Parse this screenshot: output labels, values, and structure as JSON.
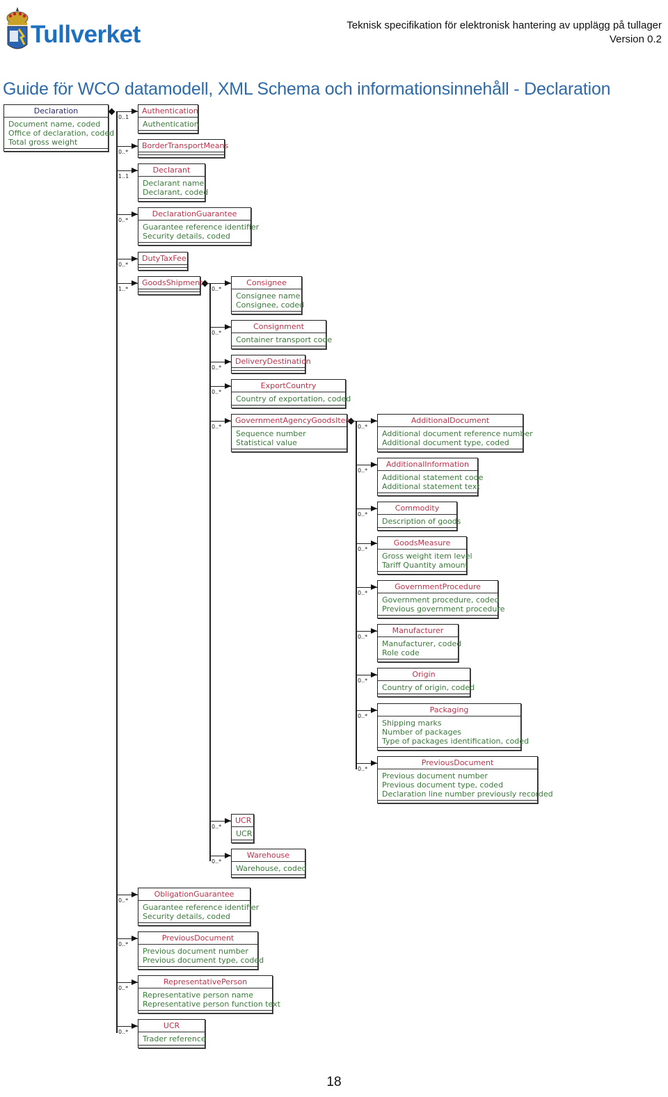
{
  "header": {
    "logo_text": "Tullverket",
    "doc_title": "Teknisk specifikation för elektronisk hantering av upplägg på tullager",
    "version": "Version 0.2"
  },
  "page_title": "Guide för WCO datamodell, XML Schema och informationsinnehåll - Declaration",
  "page_number": "18",
  "diagram": {
    "root": {
      "name": "Declaration",
      "attributes": [
        "Document name, coded",
        "Office of declaration, coded",
        "Total gross weight"
      ]
    },
    "level1": [
      {
        "name": "Authentication",
        "multiplicity": "0..1",
        "attributes": [
          "Authentication"
        ]
      },
      {
        "name": "BorderTransportMeans",
        "multiplicity": "0..*",
        "attributes": []
      },
      {
        "name": "Declarant",
        "multiplicity": "1..1",
        "attributes": [
          "Declarant name",
          "Declarant, coded"
        ]
      },
      {
        "name": "DeclarationGuarantee",
        "multiplicity": "0..*",
        "attributes": [
          "Guarantee reference identifier",
          "Security details, coded"
        ]
      },
      {
        "name": "DutyTaxFee",
        "multiplicity": "0..*",
        "attributes": []
      },
      {
        "name": "GoodsShipment",
        "multiplicity": "1..*",
        "attributes": []
      },
      {
        "name": "ObligationGuarantee",
        "multiplicity": "0..*",
        "attributes": [
          "Guarantee reference identifier",
          "Security details, coded"
        ]
      },
      {
        "name": "PreviousDocument",
        "multiplicity": "0..*",
        "attributes": [
          "Previous document number",
          "Previous document type, coded"
        ]
      },
      {
        "name": "RepresentativePerson",
        "multiplicity": "0..*",
        "attributes": [
          "Representative person name",
          "Representative person function text"
        ]
      },
      {
        "name": "UCR",
        "multiplicity": "0..*",
        "attributes": [
          "Trader reference"
        ]
      }
    ],
    "goods_shipment_children": [
      {
        "name": "Consignee",
        "multiplicity": "0..*",
        "attributes": [
          "Consignee name",
          "Consignee, coded"
        ]
      },
      {
        "name": "Consignment",
        "multiplicity": "0..*",
        "attributes": [
          "Container transport code"
        ]
      },
      {
        "name": "DeliveryDestination",
        "multiplicity": "0..*",
        "attributes": []
      },
      {
        "name": "ExportCountry",
        "multiplicity": "0..*",
        "attributes": [
          "Country of exportation, coded"
        ]
      },
      {
        "name": "GovernmentAgencyGoodsItem",
        "multiplicity": "0..*",
        "attributes": [
          "Sequence number",
          "Statistical value"
        ]
      },
      {
        "name": "UCR",
        "multiplicity": "0..*",
        "attributes": [
          "UCR"
        ]
      },
      {
        "name": "Warehouse",
        "multiplicity": "0..*",
        "attributes": [
          "Warehouse, coded"
        ]
      }
    ],
    "goods_item_children": [
      {
        "name": "AdditionalDocument",
        "multiplicity": "0..*",
        "attributes": [
          "Additional document reference number",
          "Additional document type, coded"
        ]
      },
      {
        "name": "AdditionalInformation",
        "multiplicity": "0..*",
        "attributes": [
          "Additional statement code",
          "Additional statement text"
        ]
      },
      {
        "name": "Commodity",
        "multiplicity": "0..*",
        "attributes": [
          "Description of goods"
        ]
      },
      {
        "name": "GoodsMeasure",
        "multiplicity": "0..*",
        "attributes": [
          "Gross weight item level",
          "Tariff Quantity amount"
        ]
      },
      {
        "name": "GovernmentProcedure",
        "multiplicity": "0..*",
        "attributes": [
          "Government procedure, coded",
          "Previous government procedure"
        ]
      },
      {
        "name": "Manufacturer",
        "multiplicity": "0..*",
        "attributes": [
          "Manufacturer, coded",
          "Role code"
        ]
      },
      {
        "name": "Origin",
        "multiplicity": "0..*",
        "attributes": [
          "Country of origin, coded"
        ]
      },
      {
        "name": "Packaging",
        "multiplicity": "0..*",
        "attributes": [
          "Shipping marks",
          "Number of packages",
          "Type of packages identification, coded"
        ]
      },
      {
        "name": "PreviousDocument",
        "multiplicity": "0..*",
        "attributes": [
          "Previous document number",
          "Previous document type, coded",
          "Declaration line number previously recorded"
        ]
      }
    ]
  }
}
